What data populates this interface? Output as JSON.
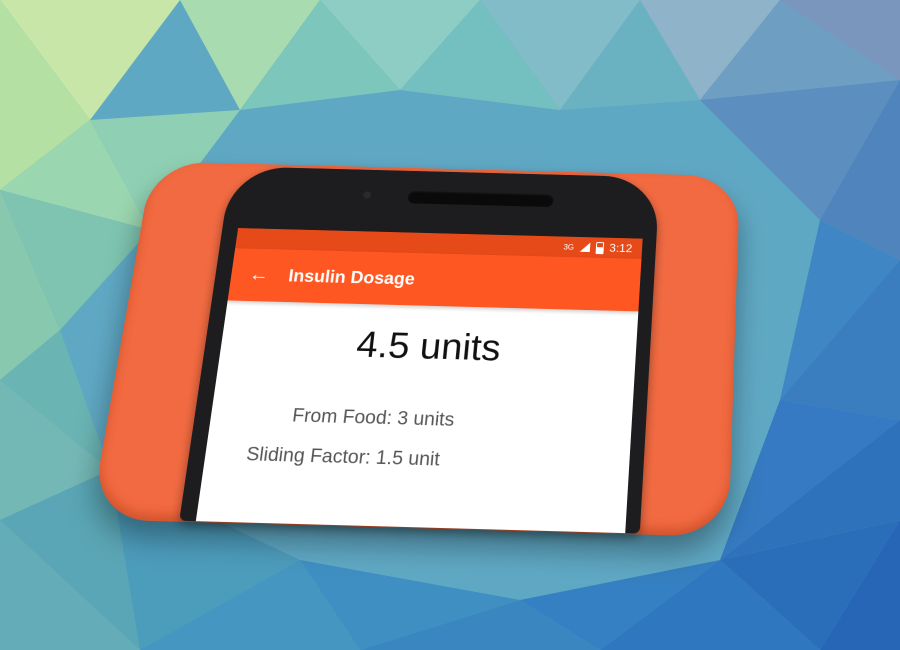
{
  "status_bar": {
    "network": "3G",
    "time": "3:12"
  },
  "app_bar": {
    "back_icon": "arrow-left-icon",
    "title": "Insulin Dosage"
  },
  "dosage": {
    "total": "4.5 units",
    "from_food": "From Food: 3 units",
    "sliding_factor": "Sliding Factor: 1.5 unit"
  },
  "colors": {
    "badge": "#f26a41",
    "app_bar": "#ff5722",
    "status_bar": "#e64a19",
    "phone_body": "#1d1d1f"
  }
}
